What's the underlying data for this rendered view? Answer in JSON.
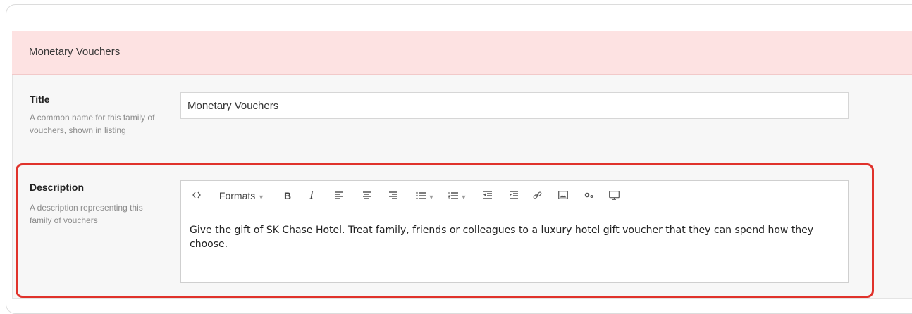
{
  "panel": {
    "header_title": "Monetary Vouchers"
  },
  "title_field": {
    "label": "Title",
    "help": "A common name for this family of vouchers, shown in listing",
    "value": "Monetary Vouchers"
  },
  "description_field": {
    "label": "Description",
    "help": "A description representing this family of vouchers",
    "toolbar": {
      "source_code_icon": "code-icon",
      "formats_label": "Formats",
      "bold_label": "B",
      "italic_label": "I",
      "icons": [
        "align-left-icon",
        "align-center-icon",
        "align-right-icon",
        "bullet-list-icon",
        "numbered-list-icon",
        "outdent-icon",
        "indent-icon",
        "link-icon",
        "image-icon",
        "settings-icon",
        "preview-icon"
      ]
    },
    "content": "Give the gift of SK Chase Hotel. Treat family, friends or colleagues to a luxury hotel gift voucher that they can spend how they choose."
  },
  "colors": {
    "header_bg": "#fde2e2",
    "highlight": "#e0322b"
  }
}
